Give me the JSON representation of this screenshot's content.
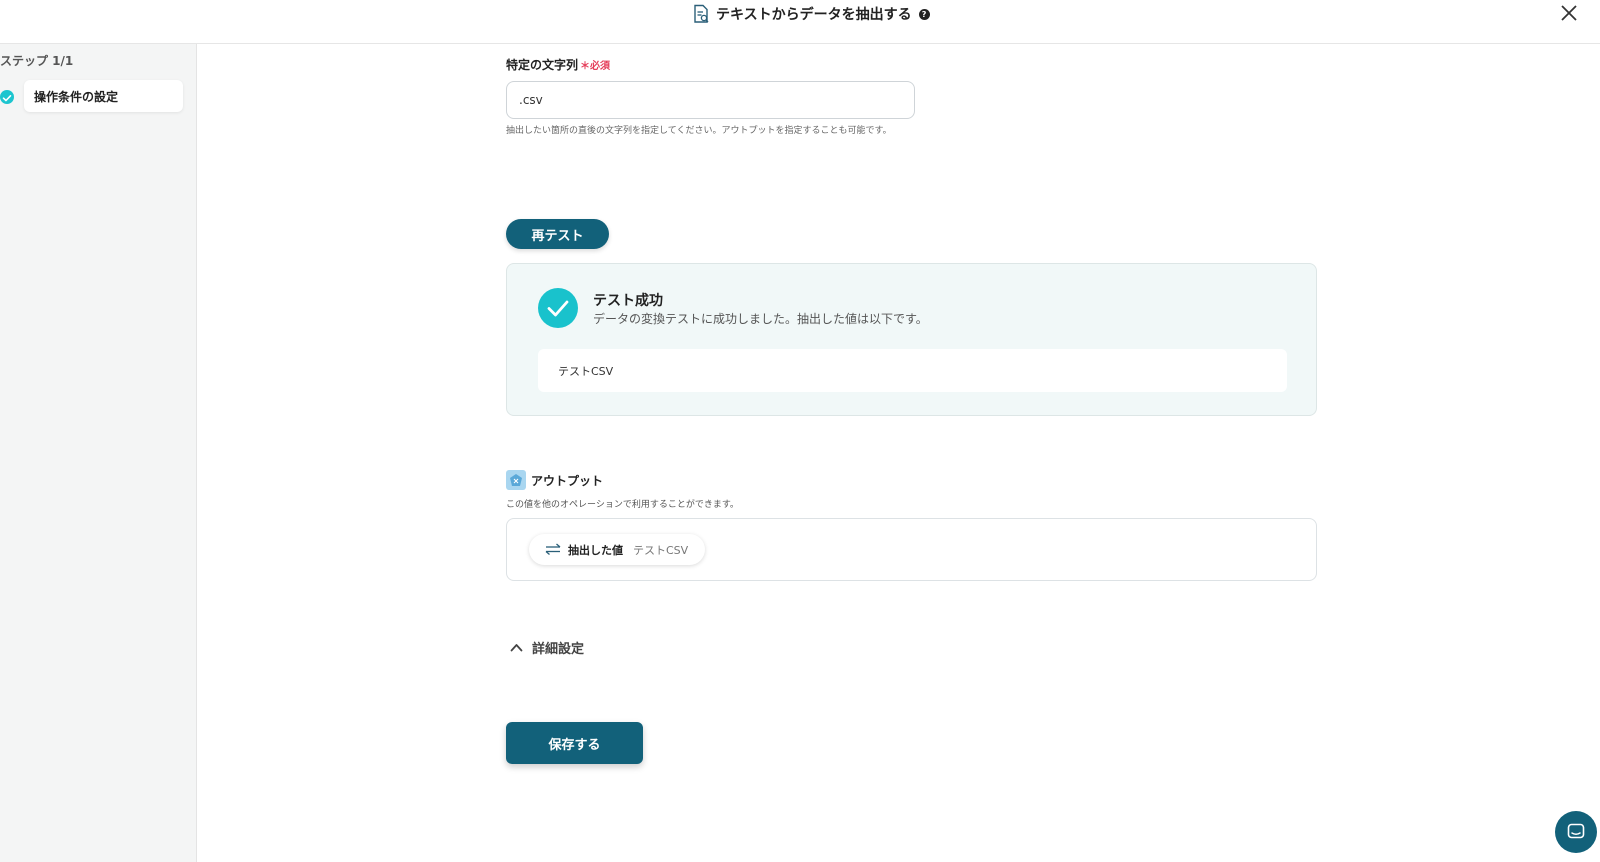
{
  "header": {
    "title": "テキストからデータを抽出する",
    "help_icon": "question-circle-icon",
    "close_icon": "close-icon"
  },
  "sidebar": {
    "step_label": "ステップ 1/1",
    "steps": [
      {
        "label": "操作条件の設定",
        "status": "completed",
        "icon": "check-circle-icon"
      }
    ]
  },
  "form": {
    "field": {
      "label": "特定の文字列",
      "required_label": "必須",
      "required_mark": "＊",
      "value": ".csv",
      "help": "抽出したい箇所の直後の文字列を指定してください。アウトプットを指定することも可能です。"
    },
    "retest_label": "再テスト"
  },
  "test_result": {
    "title": "テスト成功",
    "description": "データの変換テストに成功しました。抽出した値は以下です。",
    "value": "テストCSV"
  },
  "output": {
    "title": "アウトプット",
    "description": "この値を他のオペレーションで利用することができます。",
    "items": [
      {
        "name": "抽出した値",
        "value": "テストCSV",
        "icon": "swap-arrows-icon"
      }
    ]
  },
  "advanced": {
    "label": "詳細設定",
    "icon": "chevron-up-icon"
  },
  "save_label": "保存する",
  "colors": {
    "primary": "#12617a",
    "success": "#19c2cc",
    "required": "#e53e5a"
  }
}
